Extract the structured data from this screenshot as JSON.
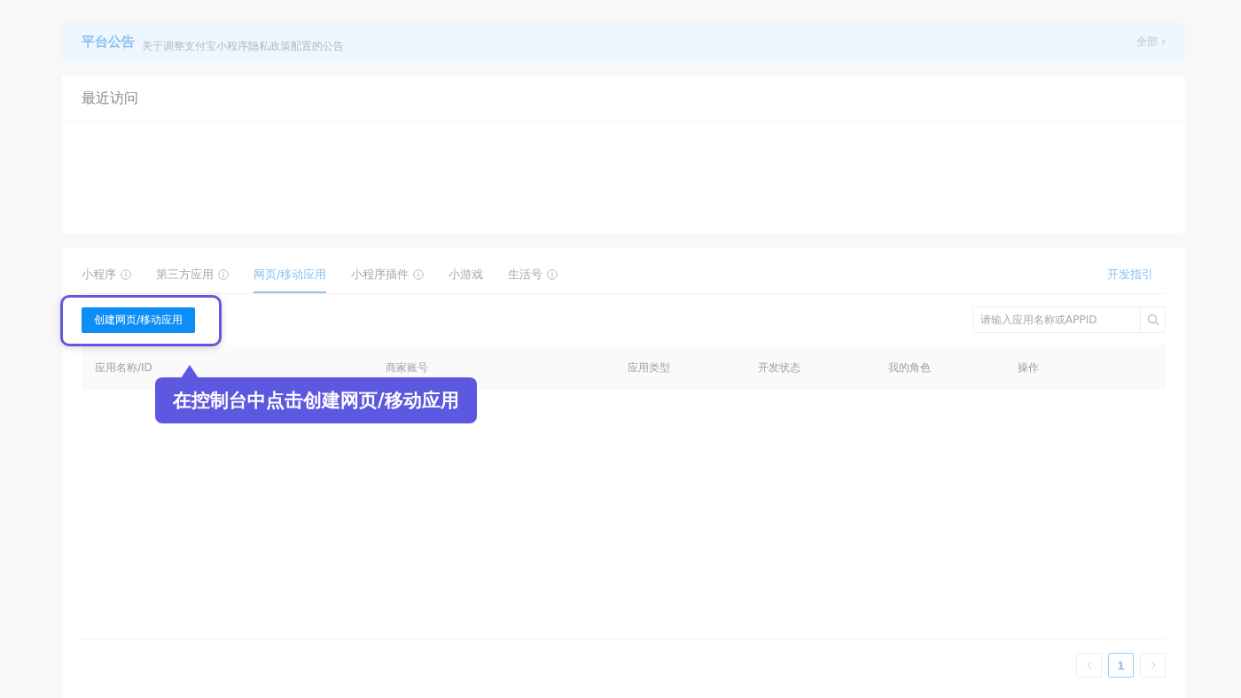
{
  "announcement": {
    "label": "平台公告",
    "text": "关于调整支付宝小程序隐私政策配置的公告",
    "more": "全部 ›"
  },
  "recent": {
    "title": "最近访问"
  },
  "tabs": [
    {
      "label": "小程序",
      "selected": false,
      "info": true
    },
    {
      "label": "第三方应用",
      "selected": false,
      "info": true
    },
    {
      "label": "网页/移动应用",
      "selected": true,
      "info": false
    },
    {
      "label": "小程序插件",
      "selected": false,
      "info": true
    },
    {
      "label": "小游戏",
      "selected": false,
      "info": false
    },
    {
      "label": "生活号",
      "selected": false,
      "info": true
    }
  ],
  "guide_link": "开发指引",
  "create_button": "创建网页/移动应用",
  "search": {
    "placeholder": "请输入应用名称或APPID"
  },
  "table": {
    "columns": [
      "应用名称/ID",
      "商家账号",
      "应用类型",
      "开发状态",
      "我的角色",
      "操作"
    ]
  },
  "pagination": {
    "pages": [
      {
        "label": "1",
        "selected": true
      }
    ]
  },
  "callout": {
    "text": "在控制台中点击创建网页/移动应用"
  }
}
